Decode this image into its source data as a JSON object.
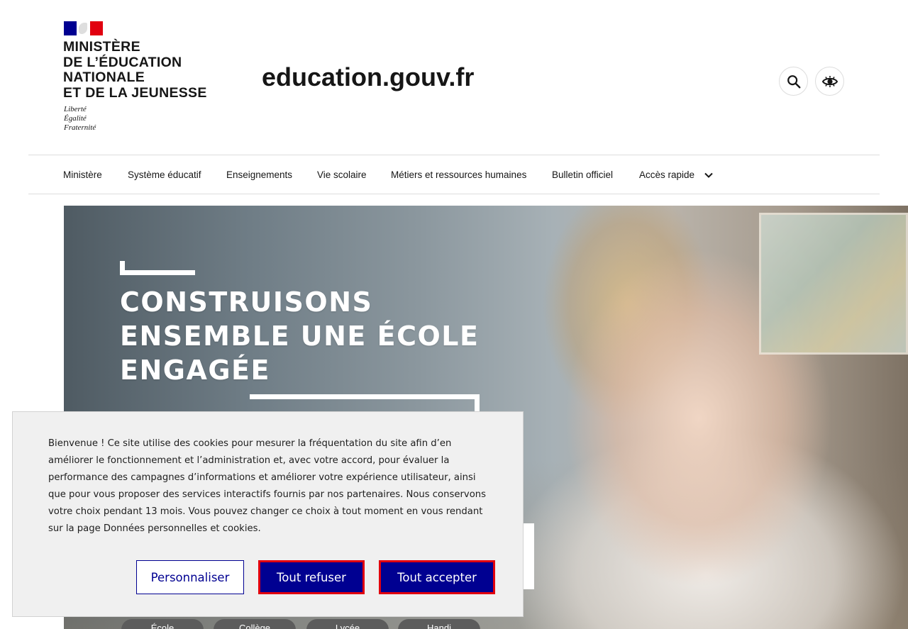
{
  "colors": {
    "primary_blue": "#000091",
    "accent_red": "#e1000f",
    "banner_bg": "#f0f0f0"
  },
  "header": {
    "ministry_lines": [
      "MINISTÈRE",
      "DE L’ÉDUCATION",
      "NATIONALE",
      "ET DE LA JEUNESSE"
    ],
    "motto_lines": [
      "Liberté",
      "Égalité",
      "Fraternité"
    ],
    "site_title": "education.gouv.fr",
    "search_icon": "search-icon",
    "accessibility_icon": "eye-icon"
  },
  "nav": {
    "items": [
      "Ministère",
      "Système éducatif",
      "Enseignements",
      "Vie scolaire",
      "Métiers et ressources humaines",
      "Bulletin officiel",
      "Accès rapide"
    ],
    "dropdown_icon": "chevron-down-icon"
  },
  "hero": {
    "title_lines": [
      "CONSTRUISONS",
      "ENSEMBLE UNE ÉCOLE",
      "ENGAGÉE"
    ],
    "chips": [
      "École",
      "Collège",
      "Lycée",
      "Handi"
    ]
  },
  "cookie_banner": {
    "text": "Bienvenue ! Ce site utilise des cookies pour mesurer la fréquentation du site afin d’en améliorer le fonctionnement et l’administration et, avec votre accord, pour évaluer la performance des campagnes d’informations et améliorer votre expérience utilisateur, ainsi que pour vous proposer des services interactifs fournis par nos partenaires. Nous conservons votre choix pendant 13 mois. Vous pouvez changer ce choix à tout moment en vous rendant sur la page Données personnelles et cookies.",
    "personalize_label": "Personnaliser",
    "refuse_label": "Tout refuser",
    "accept_label": "Tout accepter"
  }
}
